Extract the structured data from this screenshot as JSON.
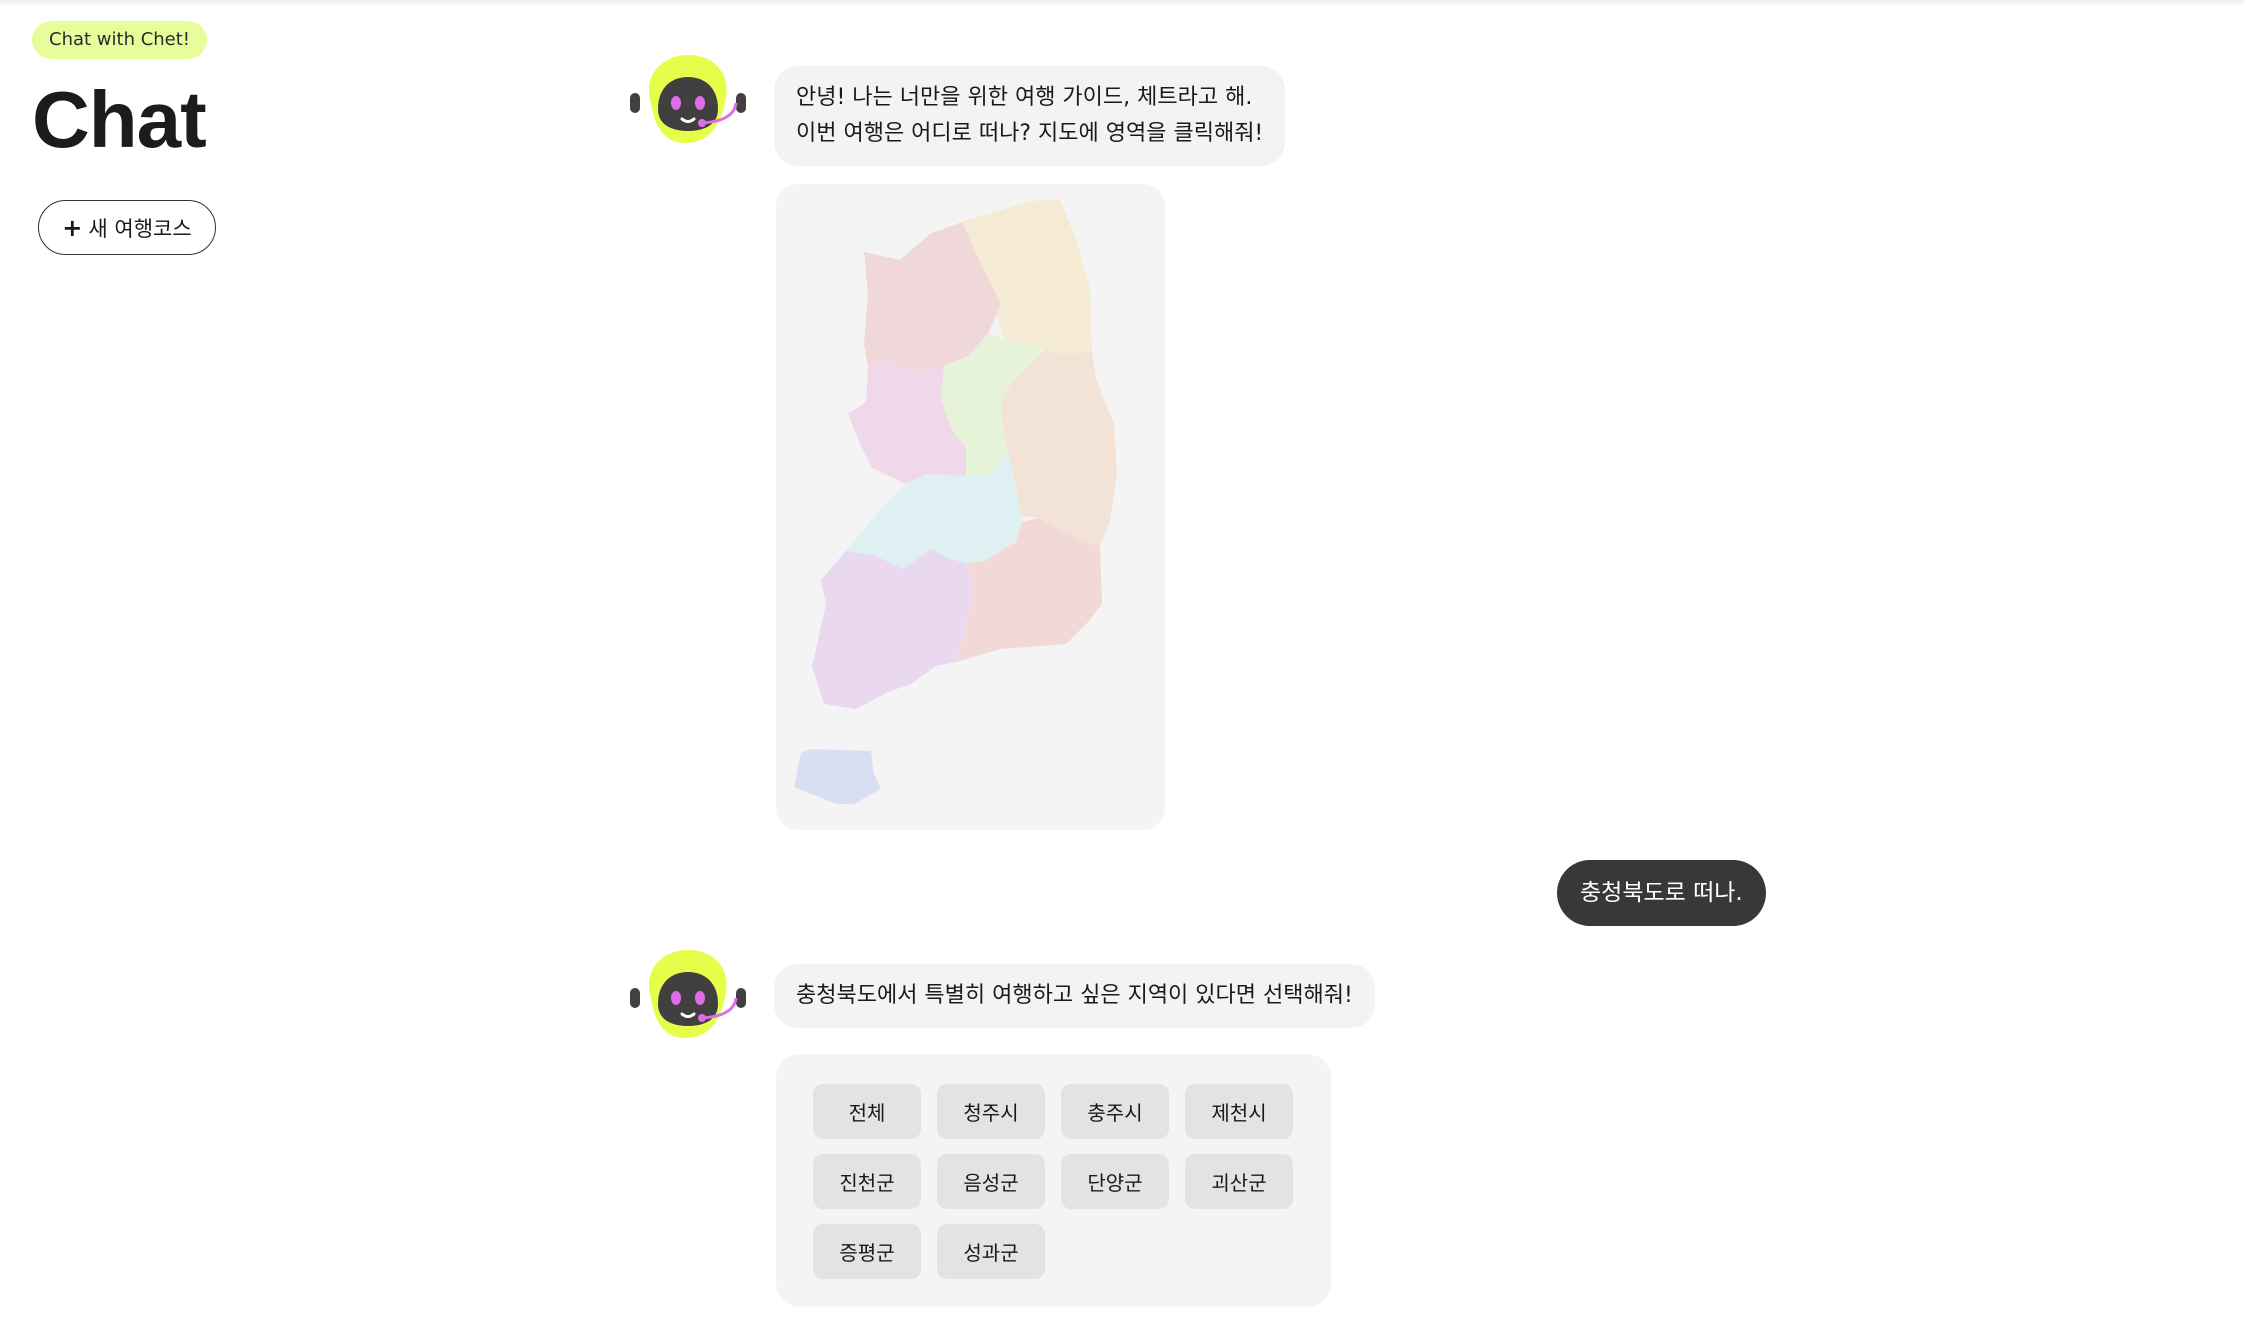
{
  "sidebar": {
    "badge": "Chat with Chet!",
    "title": "Chat",
    "new_course_plus": "+",
    "new_course_label": "새 여행코스"
  },
  "chat": {
    "bot_msg_1_line1": "안녕! 나는 너만을 위한 여행 가이드, 체트라고 해.",
    "bot_msg_1_line2": "이번 여행은 어디로 떠나? 지도에 영역을 클릭해줘!",
    "user_msg": "충청북도로 떠나.",
    "bot_msg_2": "충청북도에서 특별히 여행하고 싶은 지역이 있다면 선택해줘!",
    "region_options": [
      "전체",
      "청주시",
      "충주시",
      "제천시",
      "진천군",
      "음성군",
      "단양군",
      "괴산군",
      "증평군",
      "성과군"
    ]
  },
  "colors": {
    "badge_bg": "#e7fd9c",
    "avatar_yellow": "#e6fd4a",
    "avatar_face": "#404040",
    "avatar_eye": "#e06de8",
    "user_bubble_bg": "#383838",
    "bubble_bg": "#f3f3f3"
  },
  "icons": [
    "robot-avatar-icon",
    "plus-icon",
    "korea-map"
  ]
}
